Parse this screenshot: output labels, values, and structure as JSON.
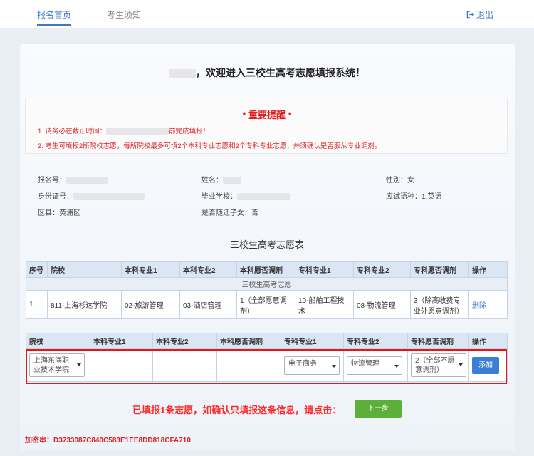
{
  "nav": {
    "tabs": [
      {
        "label": "报名首页"
      },
      {
        "label": "考生须知"
      }
    ],
    "logout_label": "退出"
  },
  "welcome": {
    "text": "，欢迎进入三校生高考志愿填报系统！"
  },
  "reminder": {
    "title": "* 重要提醒 *",
    "line1_prefix": "1. 请务必在截止时间：",
    "line1_suffix": "前完成填报！",
    "line2": "2. 考生可填报2所院校志愿，每所院校最多可填2个本科专业志愿和2个专科专业志愿，并须确认是否服从专业调剂。"
  },
  "info": {
    "reg_no_label": "报名号：",
    "name_label": "姓名：",
    "gender_label": "性别：",
    "gender_value": "女",
    "id_label": "身份证号：",
    "school_label": "毕业学校：",
    "language_label": "应试语种：",
    "language_value": "1.英语",
    "district_label": "区县：",
    "district_value": "黄浦区",
    "migrant_label": "是否随迁子女：",
    "migrant_value": "否"
  },
  "table_title": "三校生高考志愿表",
  "table": {
    "headers": [
      "序号",
      "院校",
      "本科专业1",
      "本科专业2",
      "本科愿否调剂",
      "专科专业1",
      "专科专业2",
      "专科愿否调剂",
      "操作"
    ],
    "section_label": "三校生高考志愿",
    "row": {
      "no": "1",
      "school": "811-上海杉达学院",
      "ben1": "02-旅游管理",
      "ben2": "03-酒店管理",
      "ben_adjust": "1（全部愿意调剂）",
      "zhuan1": "10-船舶工程技术",
      "zhuan2": "08-物流管理",
      "zhuan_adjust": "3（除高收费专业外愿意调剂）",
      "action": "删除"
    }
  },
  "form": {
    "headers": [
      "院校",
      "本科专业1",
      "本科专业2",
      "本科愿否调剂",
      "专科专业1",
      "专科专业2",
      "专科愿否调剂",
      "操作"
    ],
    "school_value": "上海东海职业技术学院",
    "zhuan1_value": "电子商务",
    "zhuan2_value": "物流管理",
    "zhuan_adjust_value": "2（全部不愿意调剂）",
    "add_label": "添加"
  },
  "confirm_text": "已填报1条志愿，如确认只填报这条信息，请点击：",
  "next_label": "下一步",
  "code_text": "加密串：D3733087C840C583E1EE8DD818CFA710",
  "colors": {
    "accent": "#3b78c8",
    "alert": "#e02020",
    "next_button": "#5cb03a"
  }
}
